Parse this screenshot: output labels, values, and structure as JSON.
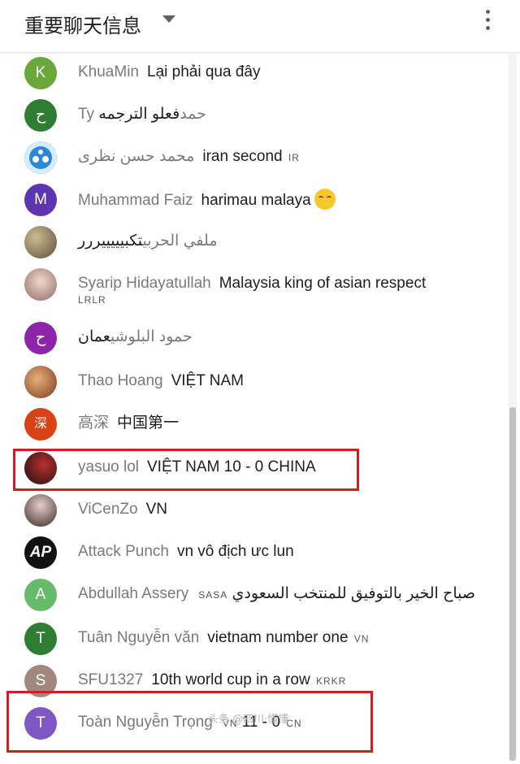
{
  "header": {
    "title": "重要聊天信息",
    "dropdown_icon": "caret-down-icon",
    "menu_icon": "more-vert-icon"
  },
  "colors": {
    "highlight": "#d01e1e",
    "author": "#7a7a7a",
    "text": "#1e1e1e"
  },
  "messages": [
    {
      "author": "KhuaMin",
      "text": "Lại phải qua đây",
      "badge": "",
      "avatar": {
        "letter": "K",
        "color": "#6aa83c"
      }
    },
    {
      "author": "Ty حمد",
      "text": "فعلو الترجمه",
      "badge": "",
      "avatar": {
        "letter": "ح",
        "color": "#2f7d32"
      }
    },
    {
      "author": "محمد حسن نظرى",
      "text": "iran second",
      "badge": "IR",
      "avatar": {
        "letter": "",
        "color": "#2c87d8"
      }
    },
    {
      "author": "Muhammad Faiz",
      "text": "harimau malaya",
      "badge": "",
      "avatar": {
        "letter": "M",
        "color": "#5e35b1"
      }
    },
    {
      "author": "ملفي الحربي",
      "text": "تكبيييييررر",
      "badge": "",
      "avatar": {
        "letter": "",
        "color": "#8d8168"
      }
    },
    {
      "author": "Syarip Hidayatullah",
      "text": "Malaysia king of asian respect",
      "badge": "LRLR",
      "avatar": {
        "letter": "",
        "color": "#c9a59a"
      }
    },
    {
      "author": "حمود البلوشي",
      "text": "عمان",
      "badge": "",
      "avatar": {
        "letter": "ح",
        "color": "#8e24aa"
      }
    },
    {
      "author": "Thao Hoang",
      "text": "VIỆT NAM",
      "badge": "",
      "avatar": {
        "letter": "",
        "color": "#b06a3a"
      }
    },
    {
      "author": "高深",
      "text": "中国第一",
      "badge": "",
      "avatar": {
        "letter": "深",
        "color": "#d84315"
      }
    },
    {
      "author": "yasuo lol",
      "text": "VIỆT NAM 10 - 0 CHINA",
      "badge": "",
      "avatar": {
        "letter": "",
        "color": "#2a1a1a"
      }
    },
    {
      "author": "ViCenZo",
      "text": "VN",
      "badge": "",
      "avatar": {
        "letter": "",
        "color": "#c7a8a0"
      }
    },
    {
      "author": "Attack Punch",
      "text": "vn vô địch ưc lun",
      "badge": "",
      "avatar": {
        "letter": "AP",
        "color": "#111111"
      }
    },
    {
      "author": "Abdullah Assery",
      "text": "صباح الخير بالتوفيق للمنتخب السعودي",
      "badge": "SASA",
      "avatar": {
        "letter": "A",
        "color": "#66bb6a"
      }
    },
    {
      "author": "Tuân Nguyễn văn",
      "text": "vietnam number one",
      "badge": "VN",
      "avatar": {
        "letter": "T",
        "color": "#2e7d32"
      }
    },
    {
      "author": "SFU1327",
      "text": "10th world cup in a row",
      "badge": "KRKR",
      "avatar": {
        "letter": "S",
        "color": "#a1887f"
      }
    },
    {
      "author": "Toàn Nguyễn Trọng",
      "text": "11 - 0",
      "badge": "",
      "pre_badge": "VN",
      "post_badge": "CN",
      "avatar": {
        "letter": "T",
        "color": "#7e57c2"
      }
    }
  ],
  "watermark": "头条 @四川·懂懂"
}
